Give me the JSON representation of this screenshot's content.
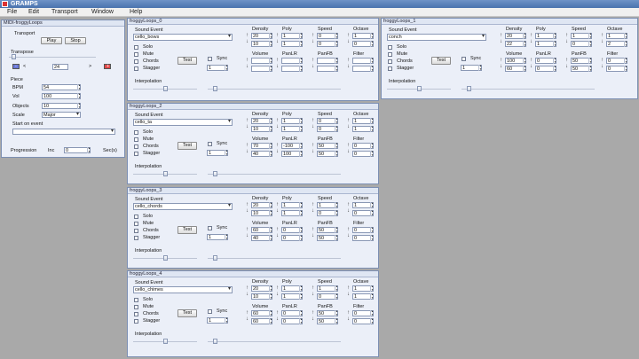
{
  "app": {
    "title": "GRAMPS"
  },
  "menu": [
    "File",
    "Edit",
    "Transport",
    "Window",
    "Help"
  ],
  "transport": {
    "window_title": "MIDI-froggyLoops",
    "section_transport": "Transport",
    "play_label": "Play",
    "stop_label": "Stop",
    "section_transpose": "Transpose",
    "transpose_value": "24",
    "minus_label": "-",
    "plus_label": "+",
    "section_piece": "Piece",
    "bpm_label": "BPM",
    "bpm_value": "54",
    "vol_label": "Vol",
    "vol_value": "100",
    "objects_label": "Objects",
    "objects_value": "10",
    "scale_label": "Scale",
    "scale_value": "Major",
    "start_event_label": "Start on event",
    "start_event_value": "",
    "progression_label": "Progression",
    "inc_label": "Inc",
    "inc_value": "0",
    "secs_label": "Sec(s)",
    "colors": {
      "minus": "#6a78d9",
      "plus": "#e24848"
    }
  },
  "common_labels": {
    "sound_event": "Sound Event",
    "solo": "Solo",
    "mute": "Mute",
    "chords": "Chords",
    "stagger": "Stagger",
    "test": "Test",
    "sync": "Sync",
    "interpolation": "Interpolation",
    "density": "Density",
    "poly": "Poly",
    "speed": "Speed",
    "octave": "Octave",
    "volume": "Volume",
    "panlr": "PanLR",
    "panfb": "PanFB",
    "filter": "Filter"
  },
  "loops": [
    {
      "title": "froggyLoops_0",
      "sound": "cello_bows",
      "sync_value": "1",
      "density": [
        "20",
        "10"
      ],
      "poly": [
        "1",
        "1"
      ],
      "speed": [
        "0",
        "0"
      ],
      "octave": [
        "1",
        "0"
      ],
      "volume": [
        "",
        ""
      ],
      "panlr": [
        "",
        ""
      ],
      "panfb": [
        "",
        ""
      ],
      "filter": [
        "",
        ""
      ]
    },
    {
      "title": "froggyLoops_1",
      "sound": "conch",
      "sync_value": "1",
      "density": [
        "20",
        "22"
      ],
      "poly": [
        "1",
        "1"
      ],
      "speed": [
        "1",
        "0"
      ],
      "octave": [
        "1",
        "2"
      ],
      "volume": [
        "100",
        "60"
      ],
      "panlr": [
        "0",
        "0"
      ],
      "panfb": [
        "50",
        "50"
      ],
      "filter": [
        "0",
        "0"
      ]
    },
    {
      "title": "froggyLoops_2",
      "sound": "cello_ta",
      "sync_value": "1",
      "density": [
        "20",
        "10"
      ],
      "poly": [
        "1",
        "1"
      ],
      "speed": [
        "0",
        "0"
      ],
      "octave": [
        "1",
        "1"
      ],
      "volume": [
        "70",
        "40"
      ],
      "panlr": [
        "-100",
        "100"
      ],
      "panfb": [
        "50",
        "50"
      ],
      "filter": [
        "0",
        "0"
      ]
    },
    {
      "title": "froggyLoops_3",
      "sound": "cello_chords",
      "sync_value": "1",
      "density": [
        "20",
        "10"
      ],
      "poly": [
        "1",
        "1"
      ],
      "speed": [
        "1",
        "0"
      ],
      "octave": [
        "1",
        "0"
      ],
      "volume": [
        "60",
        "40"
      ],
      "panlr": [
        "0",
        "0"
      ],
      "panfb": [
        "50",
        "50"
      ],
      "filter": [
        "0",
        "0"
      ]
    },
    {
      "title": "froggyLoops_4",
      "sound": "cello_chimes",
      "sync_value": "1",
      "density": [
        "20",
        "10"
      ],
      "poly": [
        "1",
        "1"
      ],
      "speed": [
        "1",
        "0"
      ],
      "octave": [
        "1",
        "1"
      ],
      "volume": [
        "60",
        "60"
      ],
      "panlr": [
        "0",
        "0"
      ],
      "panfb": [
        "50",
        "50"
      ],
      "filter": [
        "0",
        "0"
      ]
    }
  ]
}
